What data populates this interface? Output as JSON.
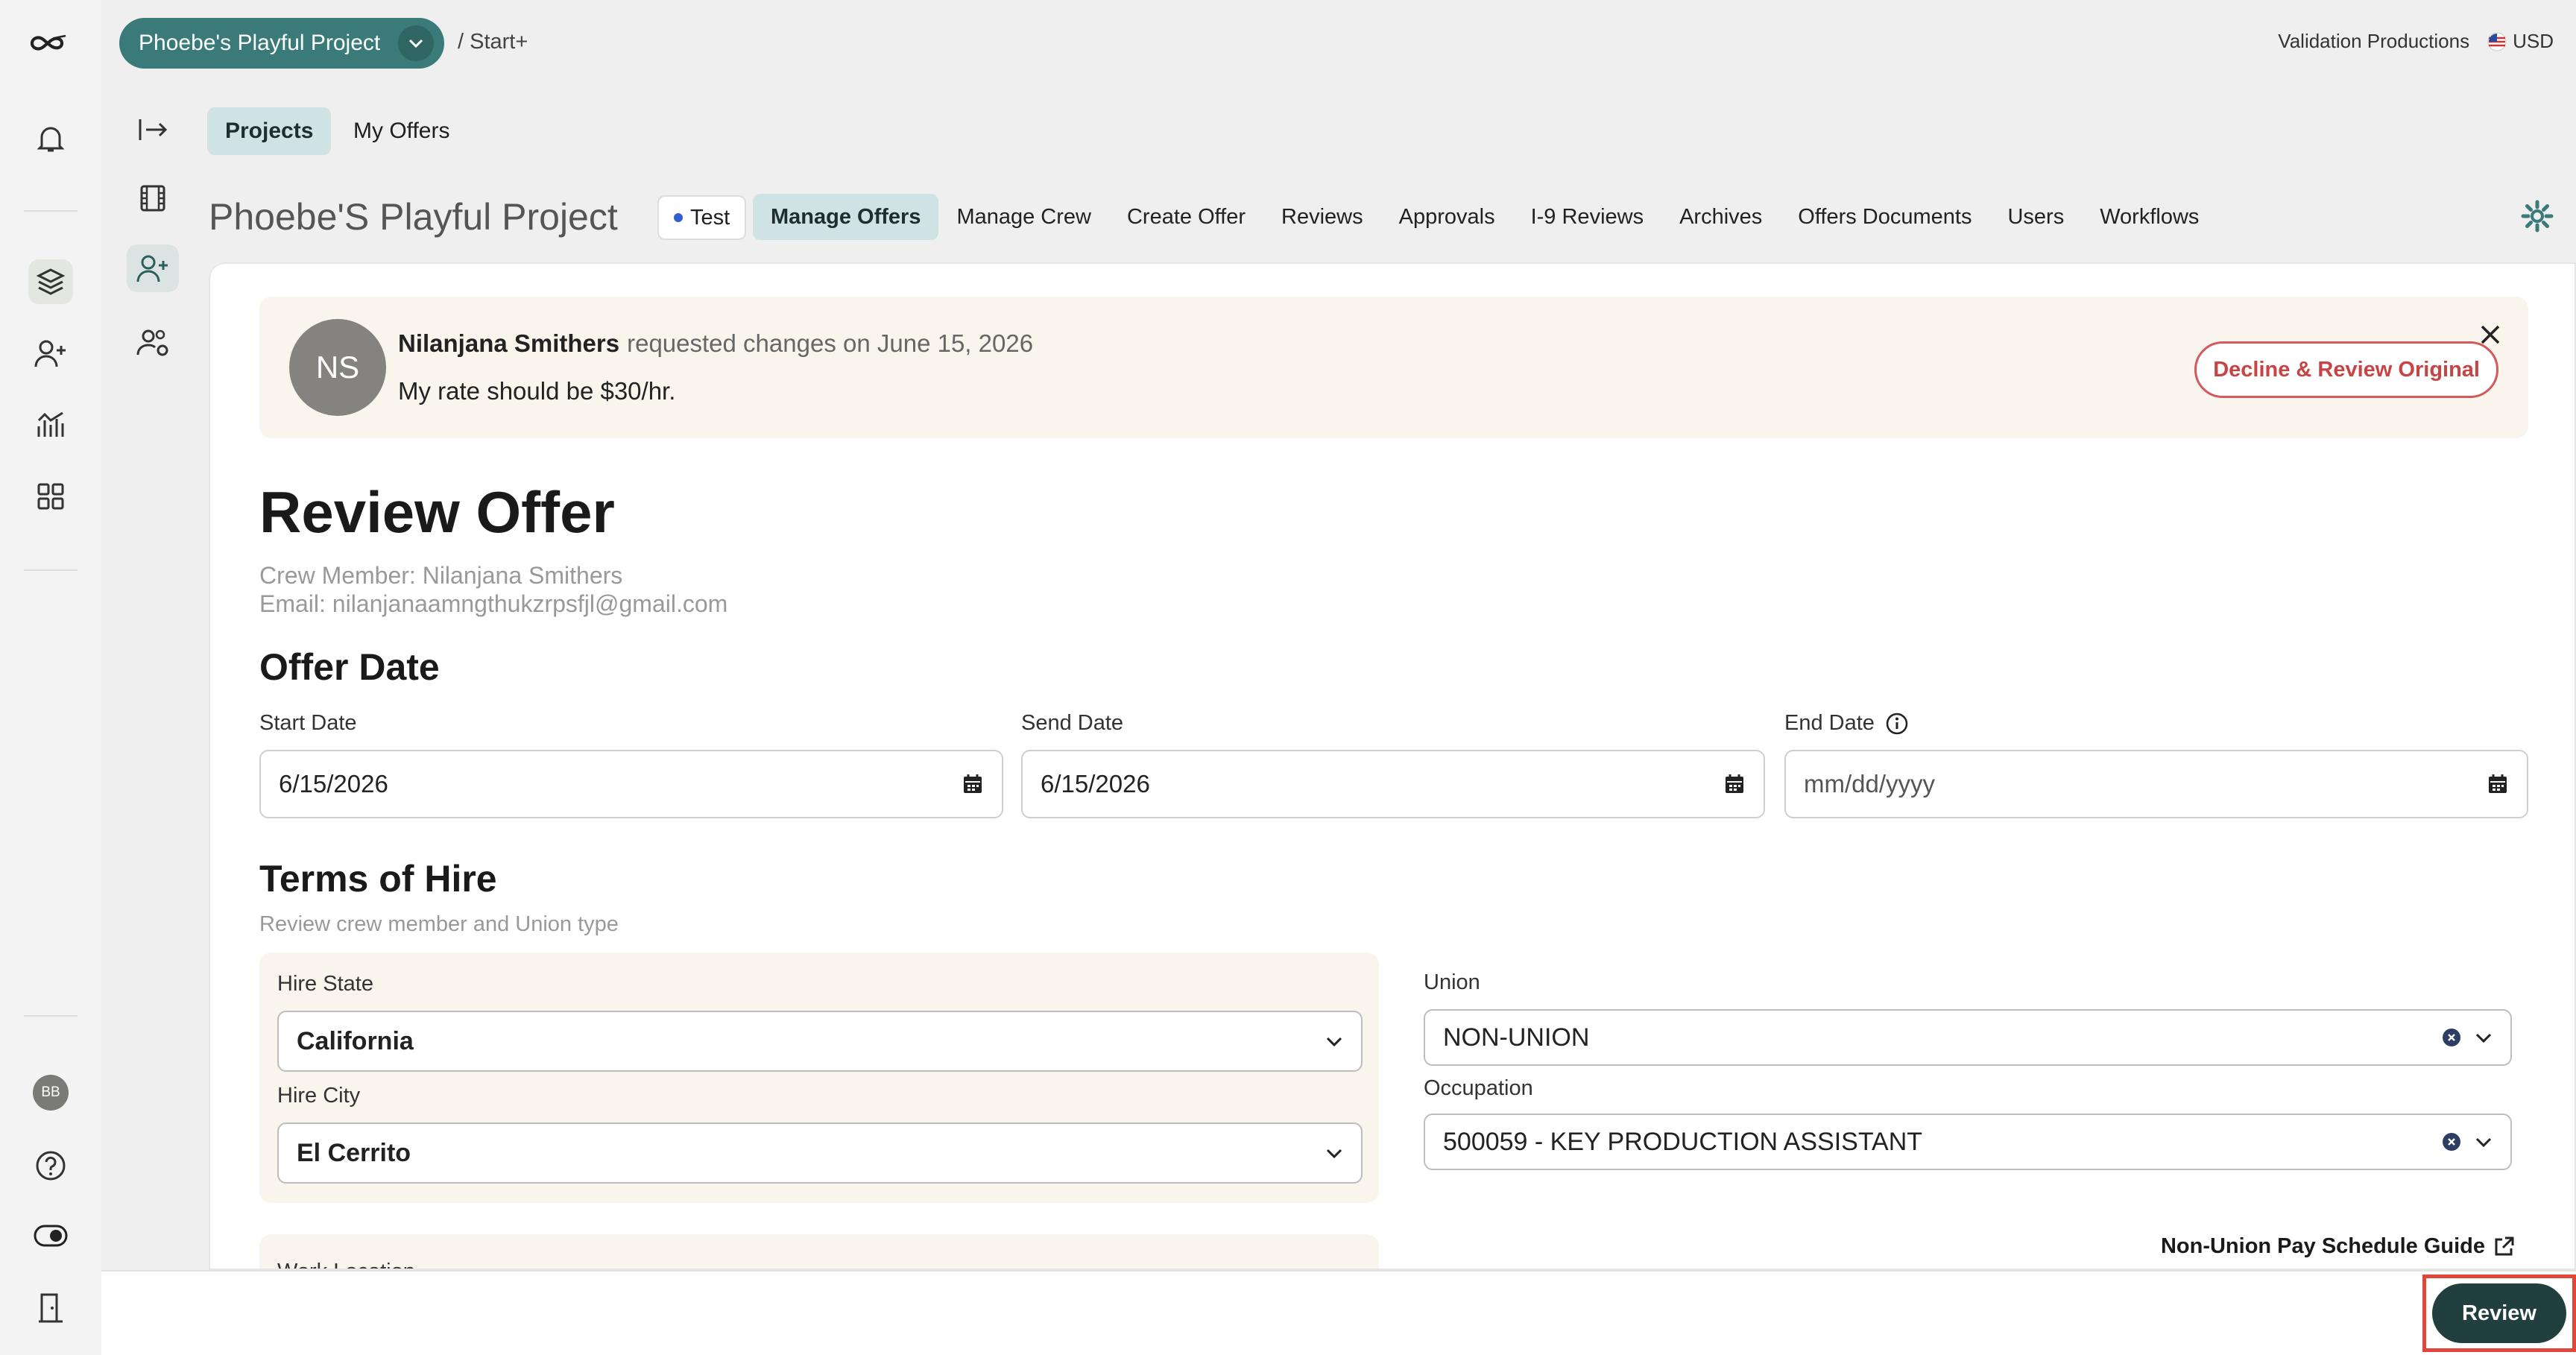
{
  "top": {
    "project_name": "Phoebe's Playful Project",
    "breadcrumb": "/ Start+",
    "company": "Validation Productions",
    "currency": "USD"
  },
  "rail": {
    "avatar_initials": "BB"
  },
  "subtabs": {
    "projects": "Projects",
    "my_offers": "My Offers"
  },
  "project": {
    "title": "Phoebe'S Playful Project",
    "chip": "Test",
    "tabs": [
      "Manage Offers",
      "Manage Crew",
      "Create Offer",
      "Reviews",
      "Approvals",
      "I-9 Reviews",
      "Archives",
      "Offers Documents",
      "Users",
      "Workflows"
    ]
  },
  "banner": {
    "initials": "NS",
    "requester": "Nilanjana Smithers",
    "action": "requested changes on June 15, 2026",
    "message": "My rate should be $30/hr.",
    "decline_label": "Decline & Review Original"
  },
  "review": {
    "title": "Review Offer",
    "crew_member": "Crew Member: Nilanjana Smithers",
    "email": "Email: nilanjanaamngthukzrpsfjl@gmail.com"
  },
  "offer_date": {
    "heading": "Offer Date",
    "start_label": "Start Date",
    "start_value": "6/15/2026",
    "send_label": "Send Date",
    "send_value": "6/15/2026",
    "end_label": "End Date",
    "end_placeholder": "mm/dd/yyyy"
  },
  "terms": {
    "heading": "Terms of Hire",
    "subtitle": "Review crew member and Union type",
    "hire_state_label": "Hire State",
    "hire_state_value": "California",
    "hire_city_label": "Hire City",
    "hire_city_value": "El Cerrito",
    "union_label": "Union",
    "union_value": "NON-UNION",
    "occupation_label": "Occupation",
    "occupation_value": "500059 - KEY PRODUCTION ASSISTANT",
    "work_location_label": "Work Location",
    "guide_label": "Non-Union Pay Schedule Guide"
  },
  "footer": {
    "review_label": "Review"
  },
  "colors": {
    "brand": "#3a7a78",
    "danger": "#d25a5a",
    "banner_bg": "#f9f4ec",
    "primary_btn": "#213f3e"
  }
}
